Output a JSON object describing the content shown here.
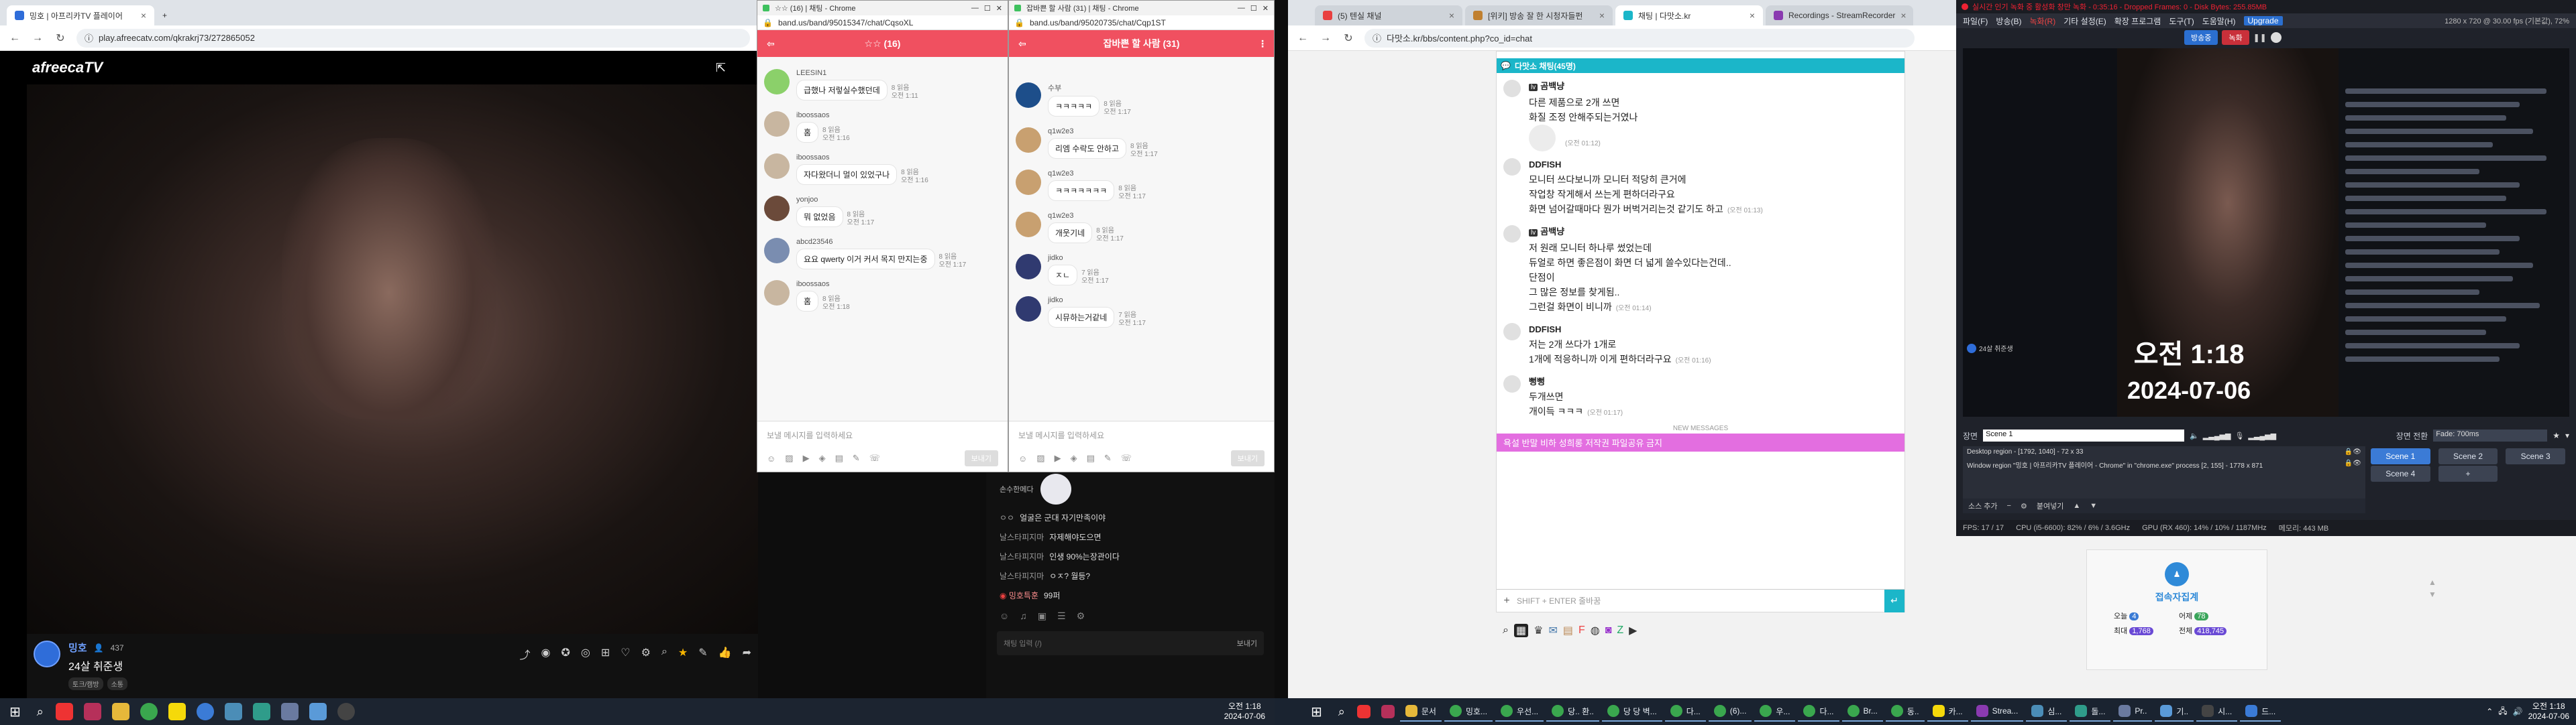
{
  "colors": {
    "band_red": "#f05060",
    "afreeca_blue": "#2f6dd9",
    "wchat_teal": "#1bb6c9",
    "wchat_notice": "#e36ee0",
    "obs_bg": "#1f222a",
    "taskbar": "#1c2430"
  },
  "browser1": {
    "tabs": [
      {
        "label": "밍호 | 아프리카TV 플레이어",
        "active": true
      },
      {
        "label": "+",
        "active": false
      }
    ],
    "url": "play.afreecatv.com/qkrakrj73/272865052"
  },
  "afreeca": {
    "logo": "afreecaTV",
    "streamer": "밍호",
    "viewers": "437",
    "title": "24살 취준생",
    "tags": [
      "토크/캠방",
      "소통"
    ],
    "chat_input_placeholder": "채팅 입력 (/)",
    "send_label": "보내기",
    "chat": [
      {
        "user": "손수한메다",
        "text": "",
        "sticker": true
      },
      {
        "user": "ㅇㅇ",
        "text": "얼굴은 군대 자기만족이야"
      },
      {
        "user": "날스타피지마",
        "text": "자제해야도으면"
      },
      {
        "user": "날스타피지마",
        "text": "인생 90%는장관이다"
      },
      {
        "user": "날스타피지마",
        "text": "ㅇㅈ? 월등?"
      },
      {
        "user": "밍호특훈",
        "text": "99퍼",
        "badge": true
      }
    ]
  },
  "band1": {
    "window_title": "☆☆ (16) | 채팅 - Chrome",
    "url": "band.us/band/95015347/chat/CqsoXL",
    "header": "☆☆ (16)",
    "placeholder": "보낼 메시지를 입력하세요",
    "send": "보내기",
    "messages": [
      {
        "name": "LEESIN1",
        "text": "급했나 저렇실수했던데",
        "read": "8 읽음",
        "time": "오전 1:11",
        "color": "#8bd06a"
      },
      {
        "name": "iboossaos",
        "text": "홈",
        "read": "8 읽음",
        "time": "오전 1:16",
        "color": "#c8b6a0"
      },
      {
        "name": "iboossaos",
        "text": "자다왔더니 멀이 있었구나",
        "read": "8 읽음",
        "time": "오전 1:16",
        "color": "#c8b6a0"
      },
      {
        "name": "yonjoo",
        "text": "뭐 없었음",
        "read": "8 읽음",
        "time": "오전 1:17",
        "color": "#6b4a3a"
      },
      {
        "name": "abcd23546",
        "text": "요요 qwerty 이거 커서 목지 만지는중",
        "read": "8 읽음",
        "time": "오전 1:17",
        "color": "#7a8db0"
      },
      {
        "name": "iboossaos",
        "text": "홈",
        "read": "8 읽음",
        "time": "오전 1:18",
        "color": "#c8b6a0"
      }
    ]
  },
  "band2": {
    "window_title": "잡바쁜 할 사람 (31) | 채팅 - Chrome",
    "url": "band.us/band/95020735/chat/Cqp1ST",
    "header": "잡바쁜 할 사람 (31)",
    "placeholder": "보낼 메시지를 입력하세요",
    "send": "보내기",
    "messages": [
      {
        "name": "수부",
        "text": "ㅋㅋㅋㅋㅋ",
        "read": "8 읽음",
        "time": "오전 1:17",
        "color": "#1d4e8a"
      },
      {
        "name": "q1w2e3",
        "text": "리엠 수락도 안하고",
        "read": "8 읽음",
        "time": "오전 1:17",
        "color": "#c8a070"
      },
      {
        "name": "q1w2e3",
        "text": "ㅋㅋㅋㅋㅋㅋㅋ",
        "read": "8 읽음",
        "time": "오전 1:17",
        "color": "#c8a070"
      },
      {
        "name": "q1w2e3",
        "text": "개웃기네",
        "read": "8 읽음",
        "time": "오전 1:17",
        "color": "#c8a070"
      },
      {
        "name": "jidko",
        "text": "ㅈㄴ",
        "read": "7 읽음",
        "time": "오전 1:17",
        "color": "#303a70"
      },
      {
        "name": "jidko",
        "text": "시뮤하는거같네",
        "read": "7 읽음",
        "time": "오전 1:17",
        "color": "#303a70"
      }
    ]
  },
  "browser2": {
    "tabs": [
      {
        "label": "(5) 텐실 채널",
        "active": false
      },
      {
        "label": "[위키] 방송 잘 한 시청자들펀",
        "active": false
      },
      {
        "label": "채팅 | 다맛소.kr",
        "active": true
      },
      {
        "label": "Recordings - StreamRecorder",
        "active": false
      }
    ],
    "url": "다맛소.kr/bbs/content.php?co_id=chat"
  },
  "wchat": {
    "header": "다맛소 채팅(45명)",
    "messages": [
      {
        "name": "곰백냥",
        "lines": [
          "다른 제품으로 2개 쓰면",
          "화질 조정 안해주되는거였나"
        ],
        "time": "(오전 01:12)",
        "sticker": true
      },
      {
        "name": "DDFISH",
        "lines": [
          "모니터 쓰다보니까 모니터 적당히 큰거에",
          "작업창 작게해서 쓰는게 편하더라구요",
          "화면 넘어갈때마다 뭔가 버벅거리는것 같기도 하고"
        ],
        "time": "(오전 01:13)"
      },
      {
        "name": "곰백냥",
        "lines": [
          "저 원래 모니터 하나루 썼었는데",
          "듀얼로 하면 좋은점이 화면 더 넓게 쓸수있다는건데..",
          "단점이",
          "그 많은 정보를 찾게됨..",
          "그런걸 화면이 비니까"
        ],
        "time": "(오전 01:14)"
      },
      {
        "name": "DDFISH",
        "lines": [
          "저는 2개 쓰다가 1개로",
          "1개에 적응하니까 이게 편하더라구요"
        ],
        "time": "(오전 01:16)"
      },
      {
        "name": "뻥뻥",
        "lines": [
          "두개쓰면",
          "개이득 ㅋㅋㅋ"
        ],
        "time": "(오전 01:17)"
      }
    ],
    "new_messages": "NEW MESSAGES",
    "notice": "욕설 반말 비하 성희롱 저작권 파일공유 금지",
    "input_placeholder": "SHIFT + ENTER 줄바꿈",
    "send_icon": "↵",
    "bottom_widget_title": "접속자집계",
    "bottom_stats": [
      {
        "label": "오늘",
        "value": "4"
      },
      {
        "label": "어제",
        "value": "78"
      },
      {
        "label": "최대",
        "value": "1,768"
      },
      {
        "label": "전체",
        "value": "418,745"
      }
    ]
  },
  "obs": {
    "title": "실시간 인기 녹화 중 활성화 창만 녹화 - 0:35:16 - Dropped Frames: 0 - Disk Bytes: 255.85MB",
    "menu": [
      "파일(F)",
      "방송(B)",
      "녹화(R)",
      "기타 설정(E)",
      "확장 프로그램",
      "도구(T)",
      "도움말(H)",
      "Upgrade"
    ],
    "resolution": "1280 x 720 @ 30.00 fps (기본값), 72%",
    "stream_btn": "방송중",
    "rec_btn": "녹화",
    "preview_time": "오전 1:18",
    "preview_date": "2024-07-06",
    "preview_caption": "24살 취준생",
    "scene_label": "장면",
    "scene_current": "Scene 1",
    "transition_label": "장면 전환",
    "transition": "Fade: 700ms",
    "sources": [
      "Desktop region - [1792, 1040] - 72 x 33",
      "Window region \"밍호 | 아프리카TV 플레이어 - Chrome\" in \"chrome.exe\" process [2, 155] - 1778 x 871"
    ],
    "scenes": [
      "Scene 1",
      "Scene 2",
      "Scene 3",
      "Scene 4",
      "+"
    ],
    "add_source": "소스 추가",
    "paste": "붙여넣기",
    "status": {
      "fps": "FPS: 17 / 17",
      "cpu": "CPU (i5-6600): 82% / 6% / 3.6GHz",
      "gpu": "GPU (RX 460): 14% / 10% / 1187MHz",
      "mem": "메모리: 443 MB"
    }
  },
  "taskbar": {
    "clock1_time": "오전 1:18",
    "clock1_date": "2024-07-06",
    "clock2_time": "오전 1:18",
    "clock2_date": "2024-07-06",
    "items": [
      "문서",
      "밍호...",
      "우선...",
      "당.. 환..",
      "당 당 벽...",
      "다...",
      "(6)...",
      "우...",
      "다...",
      "Br...",
      "동..",
      "카...",
      "Strea...",
      "심...",
      "돌...",
      "Pr..",
      "기..",
      "시...",
      "드..."
    ]
  }
}
